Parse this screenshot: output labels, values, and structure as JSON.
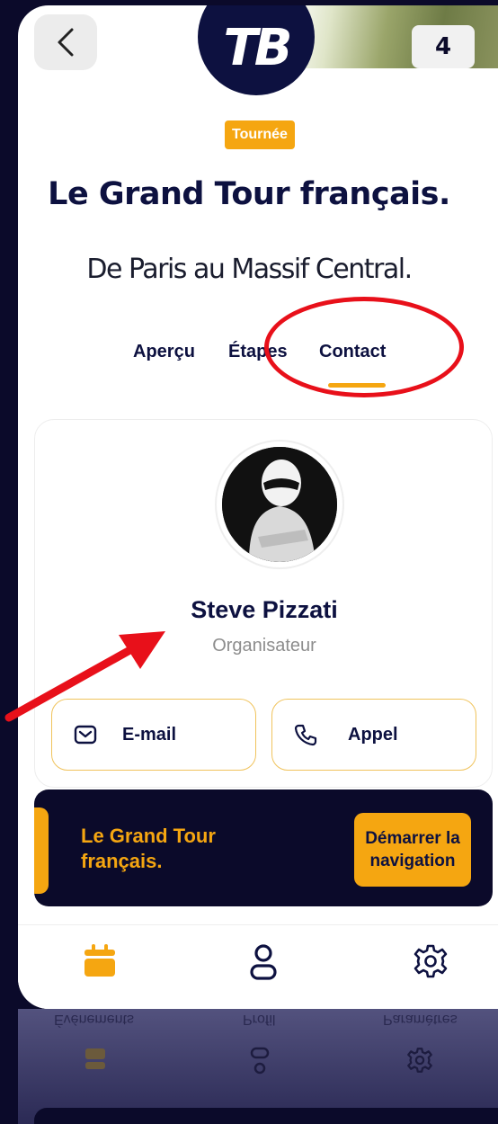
{
  "header": {
    "logo_text": "TB",
    "count_badge": "4"
  },
  "event": {
    "tag": "Tournée",
    "title": "Le Grand Tour français.",
    "subtitle": "De Paris au Massif Central."
  },
  "tabs": [
    {
      "label": "Aperçu",
      "active": false
    },
    {
      "label": "Étapes",
      "active": false
    },
    {
      "label": "Contact",
      "active": true
    }
  ],
  "contact": {
    "name": "Steve Pizzati",
    "role": "Organisateur",
    "email_label": "E-mail",
    "call_label": "Appel"
  },
  "navigation_banner": {
    "title": "Le Grand Tour français.",
    "button_label": "Démarrer la navigation"
  },
  "bottom_nav": [
    {
      "label": "Événements",
      "icon": "calendar-icon",
      "active": true
    },
    {
      "label": "Profil",
      "icon": "user-icon",
      "active": false
    },
    {
      "label": "Paramètres",
      "icon": "gear-icon",
      "active": false
    }
  ],
  "colors": {
    "accent": "#f5a611",
    "navy": "#0d1140",
    "background": "#0b0a2a",
    "annotation": "#e8101a"
  }
}
